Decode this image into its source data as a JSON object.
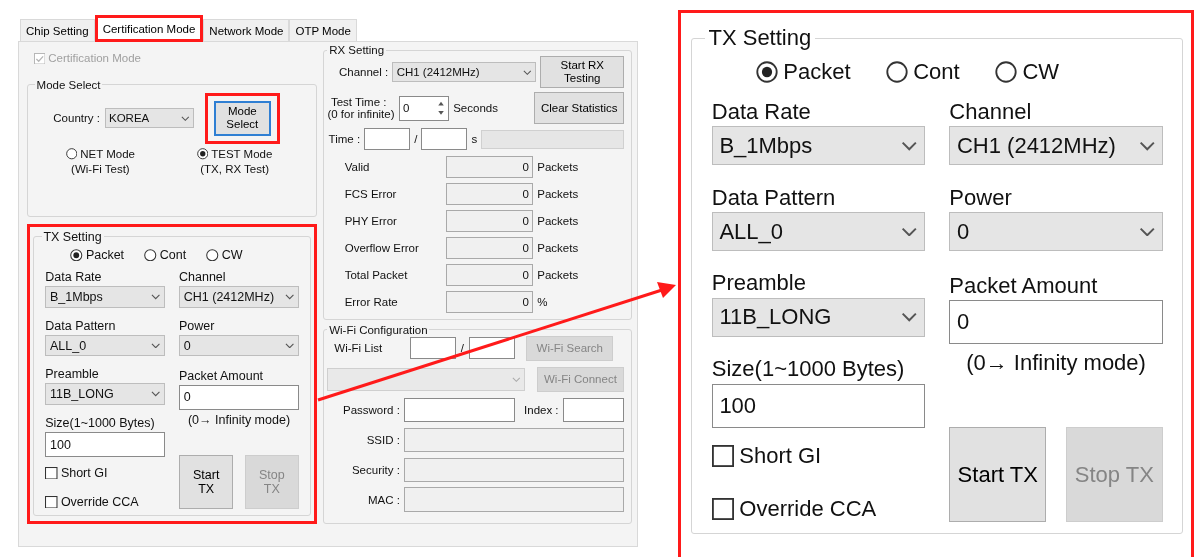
{
  "tabs": [
    {
      "label": "Chip Setting",
      "selected": false,
      "highlighted": false
    },
    {
      "label": "Certification Mode",
      "selected": true,
      "highlighted": true
    },
    {
      "label": "Network Mode",
      "selected": false,
      "highlighted": false
    },
    {
      "label": "OTP Mode",
      "selected": false,
      "highlighted": false
    }
  ],
  "certification_mode": {
    "label": "Certification Mode",
    "checked": true,
    "disabled": true
  },
  "mode_select": {
    "title": "Mode Select",
    "country_label": "Country :",
    "country": "KOREA",
    "button": {
      "label": "Mode Select",
      "highlighted": true
    },
    "modes": [
      {
        "label": "NET Mode",
        "note": "(Wi-Fi Test)",
        "selected": false
      },
      {
        "label": "TEST Mode",
        "note": "(TX, RX Test)",
        "selected": true
      }
    ]
  },
  "tx_setting": {
    "title": "TX Setting",
    "highlighted": true,
    "modes": [
      {
        "label": "Packet",
        "selected": true
      },
      {
        "label": "Cont",
        "selected": false
      },
      {
        "label": "CW",
        "selected": false
      }
    ],
    "data_rate": {
      "label": "Data Rate",
      "value": "B_1Mbps"
    },
    "channel": {
      "label": "Channel",
      "value": "CH1 (2412MHz)"
    },
    "data_pattern": {
      "label": "Data Pattern",
      "value": "ALL_0"
    },
    "power": {
      "label": "Power",
      "value": "0"
    },
    "preamble": {
      "label": "Preamble",
      "value": "11B_LONG"
    },
    "packet_amount": {
      "label": "Packet Amount",
      "value": "0"
    },
    "packet_amount_hint": "(0→ Infinity mode)",
    "size": {
      "label": "Size(1~1000 Bytes)",
      "value": "100"
    },
    "options": [
      {
        "label": "Short GI",
        "checked": false
      },
      {
        "label": "Override CCA",
        "checked": false
      }
    ],
    "buttons": [
      {
        "label": "Start TX",
        "disabled": false
      },
      {
        "label": "Stop TX",
        "disabled": true
      }
    ]
  },
  "rx_setting": {
    "title": "RX Setting",
    "channel_label": "Channel :",
    "channel": "CH1 (2412MHz)",
    "start_button": "Start RX Testing",
    "test_time_label": "Test Time :",
    "test_time_note": "(0 for infinite)",
    "test_time": "0",
    "test_time_unit": "Seconds",
    "clear_button": "Clear Statistics",
    "time_label": "Time :",
    "time_separator": "/",
    "time_unit": "s",
    "progress": {
      "level": 0
    },
    "stats": [
      {
        "label": "Valid",
        "value": "0",
        "unit": "Packets"
      },
      {
        "label": "FCS Error",
        "value": "0",
        "unit": "Packets"
      },
      {
        "label": "PHY Error",
        "value": "0",
        "unit": "Packets"
      },
      {
        "label": "Overflow Error",
        "value": "0",
        "unit": "Packets"
      },
      {
        "label": "Total Packet",
        "value": "0",
        "unit": "Packets"
      },
      {
        "label": "Error Rate",
        "value": "0",
        "unit": "%"
      }
    ]
  },
  "wifi_configuration": {
    "title": "Wi-Fi Configuration",
    "list_label": "Wi-Fi List",
    "list_separator": "/",
    "search_button": {
      "label": "Wi-Fi Search",
      "disabled": true
    },
    "network_dropdown": {
      "disabled": true
    },
    "connect_button": {
      "label": "Wi-Fi Connect",
      "disabled": true
    },
    "password_label": "Password :",
    "index_label": "Index :",
    "ssid_label": "SSID :",
    "security_label": "Security :",
    "mac_label": "MAC :"
  },
  "zoom_callout": {
    "tx_setting": {
      "title": "TX Setting",
      "modes": [
        {
          "label": "Packet",
          "selected": true
        },
        {
          "label": "Cont",
          "selected": false
        },
        {
          "label": "CW",
          "selected": false
        }
      ],
      "data_rate": {
        "label": "Data Rate",
        "value": "B_1Mbps"
      },
      "channel": {
        "label": "Channel",
        "value": "CH1 (2412MHz)"
      },
      "data_pattern": {
        "label": "Data Pattern",
        "value": "ALL_0"
      },
      "power": {
        "label": "Power",
        "value": "0"
      },
      "preamble": {
        "label": "Preamble",
        "value": "11B_LONG"
      },
      "packet_amount": {
        "label": "Packet Amount",
        "value": "0"
      },
      "packet_amount_hint": "(0→ Infinity mode)",
      "size": {
        "label": "Size(1~1000 Bytes)",
        "value": "100"
      },
      "options": [
        {
          "label": "Short GI",
          "checked": false
        },
        {
          "label": "Override CCA",
          "checked": false
        }
      ],
      "buttons": [
        {
          "label": "Start TX",
          "disabled": false
        },
        {
          "label": "Stop TX",
          "disabled": true
        }
      ]
    }
  }
}
